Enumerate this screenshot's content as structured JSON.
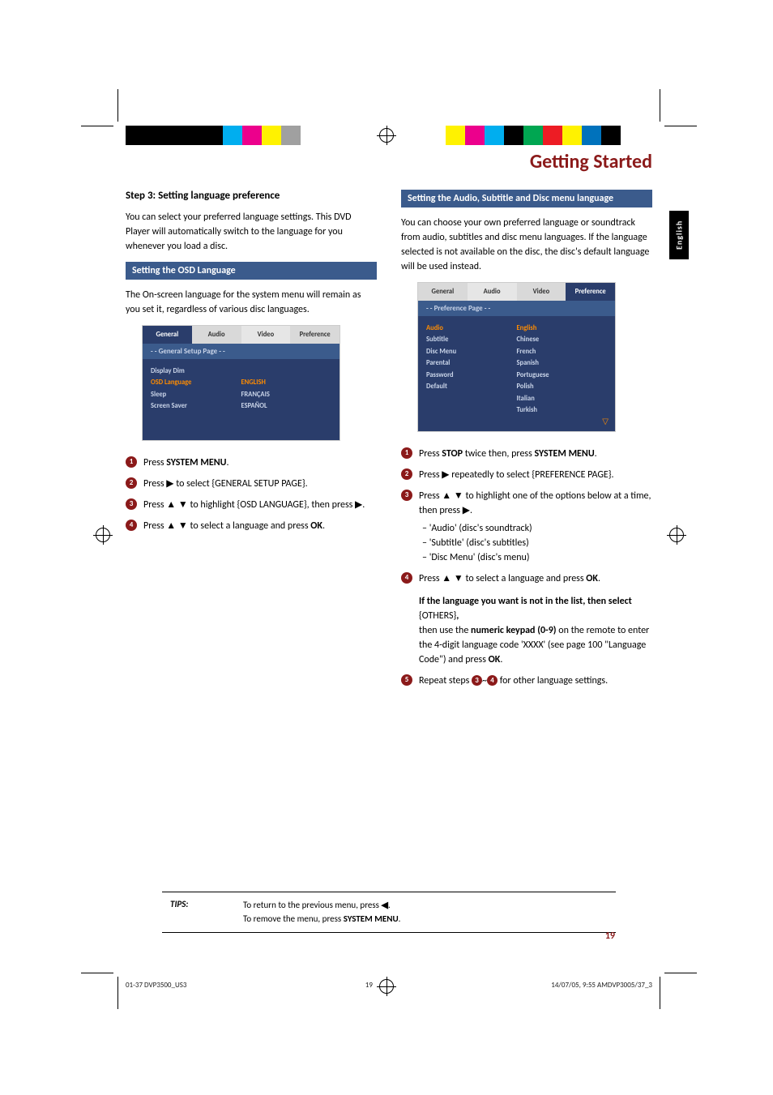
{
  "page_title": "Getting Started",
  "lang_tab": "English",
  "color_swatches_left": [
    "#000000",
    "#000000",
    "#000000",
    "#000000",
    "#000000",
    "#00AEEF",
    "#EC008C",
    "#FFF200",
    "#A0A0A0",
    "#FFFFFF"
  ],
  "color_swatches_right": [
    "#FFF200",
    "#EC008C",
    "#00AEEF",
    "#000000",
    "#00A651",
    "#ED1C24",
    "#FFF200",
    "#0072BC",
    "#000000",
    "#FFFFFF"
  ],
  "left": {
    "step_title": "Step 3:  Setting language preference",
    "intro": "You can select your preferred language settings. This DVD Player will automatically switch to the language for you whenever you load a disc.",
    "section_bar": "Setting the OSD Language",
    "section_intro": "The On-screen language for the system menu will remain as you set it, regardless of various disc languages.",
    "menu": {
      "tabs": [
        "General",
        "Audio",
        "Video",
        "Preference"
      ],
      "active_tab": 0,
      "crumb": "- -   General Setup Page   - -",
      "left_items": [
        "Display Dim",
        "OSD Language",
        "Sleep",
        "Screen Saver"
      ],
      "right_items": [
        "",
        "ENGLISH",
        "FRANÇAIS",
        "ESPAÑOL"
      ],
      "highlight_row": 1
    },
    "steps": {
      "s1_a": "Press ",
      "s1_b": "SYSTEM MENU",
      "s1_c": ".",
      "s2_a": "Press ▶ to select {GENERAL SETUP PAGE}.",
      "s3_a": "Press ▲ ▼ to highlight {OSD LANGUAGE}, then press ▶.",
      "s4_a": "Press ▲ ▼  to select a language and press ",
      "s4_b": "OK",
      "s4_c": "."
    }
  },
  "right": {
    "section_bar": "Setting the Audio, Subtitle and Disc menu language",
    "intro": "You can choose your own preferred language or soundtrack from audio, subtitles and disc menu languages. If the language selected is not available on the disc, the disc's default language will be used instead.",
    "menu": {
      "tabs": [
        "General",
        "Audio",
        "Video",
        "Preference"
      ],
      "active_tab": 3,
      "crumb": "- -   Preference Page   - -",
      "left_items": [
        "Audio",
        "Subtitle",
        "Disc Menu",
        "Parental",
        "Password",
        "Default"
      ],
      "right_items": [
        "English",
        "Chinese",
        "French",
        "Spanish",
        "Portuguese",
        "Polish",
        "Italian",
        "Turkish"
      ],
      "highlight_left": 0,
      "highlight_right": 0
    },
    "steps": {
      "s1_a": "Press ",
      "s1_b": "STOP",
      "s1_c": " twice then, press ",
      "s1_d": "SYSTEM MENU",
      "s1_e": ".",
      "s2_a": "Press ▶ repeatedly to select {PREFERENCE PAGE}.",
      "s3_a": "Press ▲ ▼ to highlight one of the options below at a time, then press ▶.",
      "s3_sub": [
        "–   'Audio' (disc's soundtrack)",
        "–   'Subtitle' (disc's subtitles)",
        "–   'Disc Menu' (disc's menu)"
      ],
      "s4_a": "Press ▲ ▼ to select a language and press ",
      "s4_b": "OK",
      "s4_c": ".",
      "note_a": "If the language you want is not in the list, then select ",
      "note_b": "{OTHERS}",
      "note_c": ",",
      "note_d": "then use the ",
      "note_e": "numeric keypad (0-9)",
      "note_f": " on the remote to enter the 4-digit language code 'XXXX' (see page 100 \"Language Code\") and press ",
      "note_g": "OK",
      "note_h": ".",
      "s5_a": "Repeat steps ",
      "s5_b": "~",
      "s5_c": " for other language settings."
    }
  },
  "tips": {
    "label": "TIPS:",
    "line1_a": "To return to the previous menu, press ",
    "line1_b": "◀",
    "line1_c": ".",
    "line2_a": "To remove the menu, press ",
    "line2_b": "SYSTEM MENU",
    "line2_c": "."
  },
  "page_number": "19",
  "footer": {
    "left": "01-37 DVP3500_US3",
    "center": "19",
    "right_time": "14/07/05, 9:55 AM",
    "right_code": "DVP3005/37_3"
  }
}
